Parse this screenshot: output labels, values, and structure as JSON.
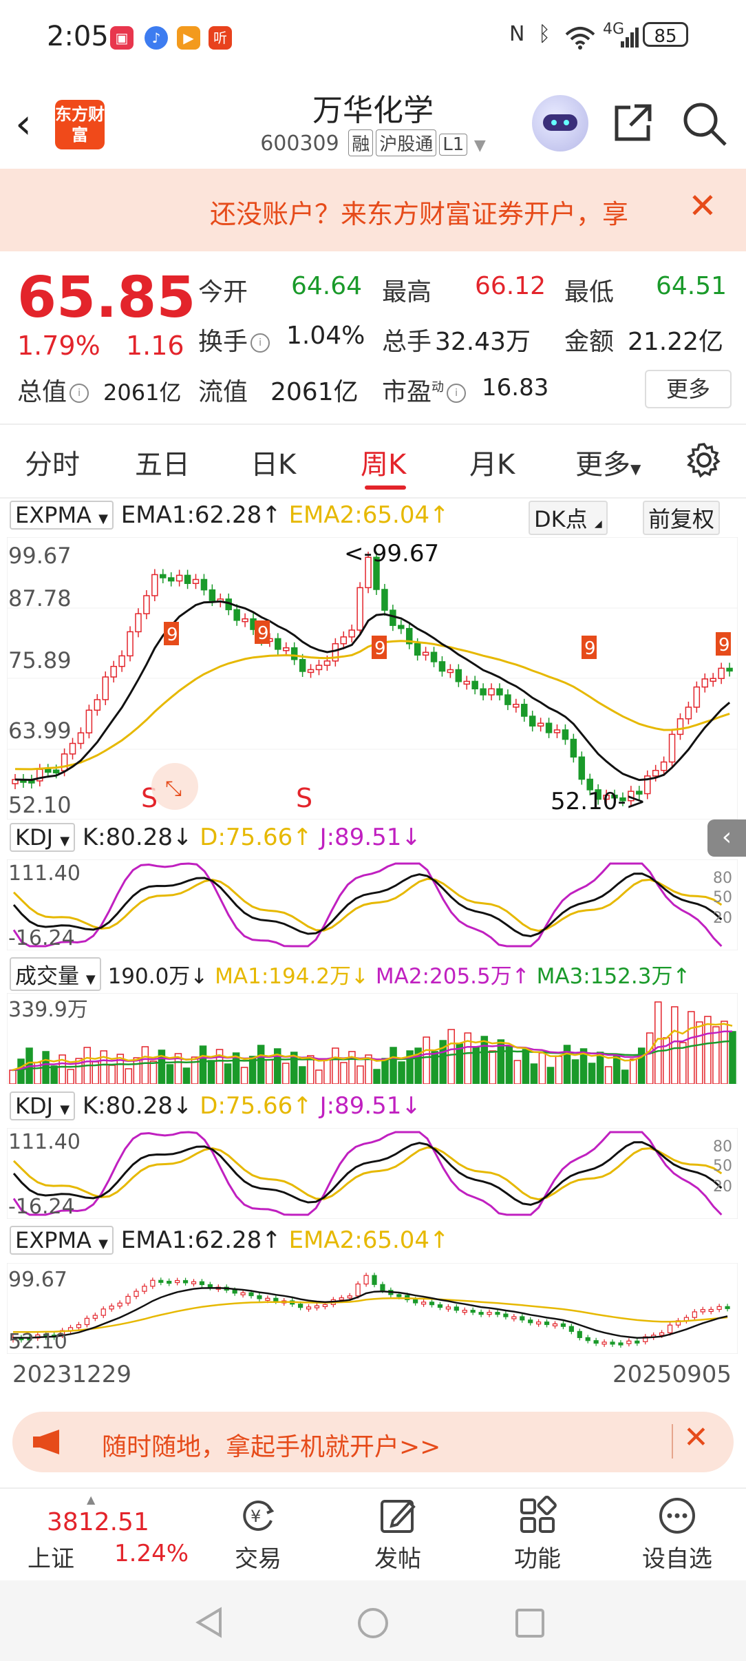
{
  "status_bar": {
    "time": "2:05",
    "battery": "85",
    "network": "4G",
    "signal_label": "6"
  },
  "header": {
    "logo_text": "东方财富",
    "stock_name": "万华化学",
    "stock_code": "600309",
    "tags": [
      "融",
      "沪股通",
      "L1"
    ]
  },
  "promo_banner": {
    "text": "还没账户？来东方财富证券开户，享"
  },
  "quote": {
    "price": "65.85",
    "change_pct": "1.79%",
    "change_amt": "1.16",
    "stats": [
      {
        "label": "今开",
        "value": "64.64",
        "color": "green"
      },
      {
        "label": "最高",
        "value": "66.12",
        "color": "red"
      },
      {
        "label": "最低",
        "value": "64.51",
        "color": "green"
      },
      {
        "label": "换手",
        "value": "1.04%",
        "color": "black"
      },
      {
        "label": "总手",
        "value": "32.43万",
        "color": "black"
      },
      {
        "label": "金额",
        "value": "21.22亿",
        "color": "black"
      },
      {
        "label": "总值",
        "value": "2061亿",
        "color": "black"
      },
      {
        "label": "流值",
        "value": "2061亿",
        "color": "black"
      },
      {
        "label": "市盈",
        "value": "16.83",
        "color": "black",
        "superscript": "动"
      }
    ],
    "more_button": "更多"
  },
  "period_tabs": [
    "分时",
    "五日",
    "日K",
    "周K",
    "月K",
    "更多"
  ],
  "active_tab": "周K",
  "main_chart": {
    "indicator": "EXPMA",
    "ema1_label": "EMA1:62.28",
    "ema2_label": "EMA2:65.04",
    "dk_button": "DK点",
    "adjust_button": "前复权",
    "y_max": "99.67",
    "y_mid1": "87.78",
    "y_mid2": "75.89",
    "y_mid3": "63.99",
    "y_min": "52.10",
    "high_annotation": "<-99.67",
    "low_annotation": "52.10->",
    "signal_s": "S",
    "nine_marker": "9"
  },
  "kdj_panel": {
    "indicator": "KDJ",
    "k_label": "K:80.28",
    "d_label": "D:75.66",
    "j_label": "J:89.51",
    "y_max": "111.40",
    "y_min": "-16.24",
    "levels": [
      "80",
      "50",
      "20"
    ]
  },
  "volume_panel": {
    "indicator": "成交量",
    "vol_label": "190.0万",
    "ma1_label": "MA1:194.2万",
    "ma2_label": "MA2:205.5万",
    "ma3_label": "MA3:152.3万",
    "y_max": "339.9万"
  },
  "kdj_panel2": {
    "indicator": "KDJ",
    "k_label": "K:80.28",
    "d_label": "D:75.66",
    "j_label": "J:89.51",
    "y_max": "111.40",
    "y_min": "-16.24",
    "levels": [
      "80",
      "50",
      "20"
    ]
  },
  "overview_chart": {
    "indicator": "EXPMA",
    "ema1_label": "EMA1:62.28",
    "ema2_label": "EMA2:65.04",
    "y_max": "99.67",
    "y_min": "52.10",
    "start_date": "20231229",
    "end_date": "20250905"
  },
  "bottom_banner": {
    "text": "随时随地，拿起手机就开户>>"
  },
  "bottom_nav": {
    "index_value": "3812.51",
    "index_name": "上证",
    "index_change": "1.24%",
    "items": [
      "交易",
      "发帖",
      "功能",
      "设自选"
    ]
  },
  "colors": {
    "up": "#e3242b",
    "down": "#1a9a2a",
    "ema1": "#111111",
    "ema2": "#e6b800",
    "j_line": "#c020c0",
    "accent": "#e64b1a"
  }
}
